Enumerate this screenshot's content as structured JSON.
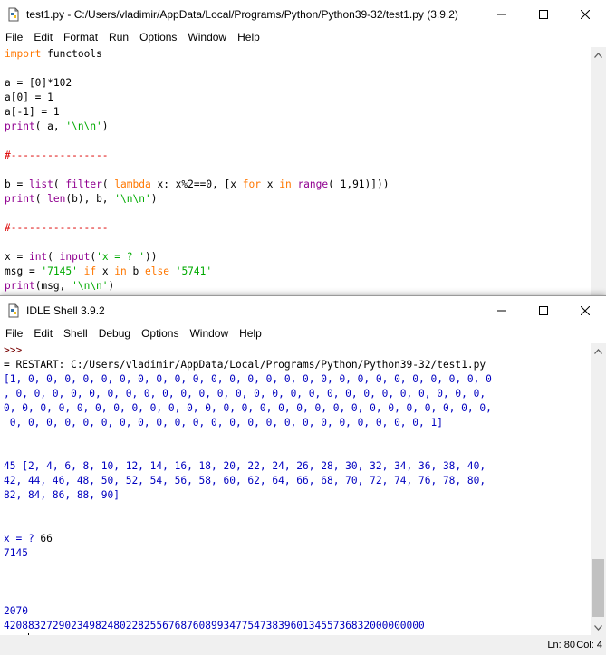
{
  "editor": {
    "title": "test1.py - C:/Users/vladimir/AppData/Local/Programs/Python/Python39-32/test1.py (3.9.2)",
    "menu": [
      "File",
      "Edit",
      "Format",
      "Run",
      "Options",
      "Window",
      "Help"
    ],
    "code": {
      "l1_kw": "import",
      "l1_rest": " functools",
      "l3": "a = [0]*102",
      "l4": "a[0] = 1",
      "l5": "a[-1] = 1",
      "l6_bi": "print",
      "l6_a": "( a, ",
      "l6_str": "'\\n\\n'",
      "l6_b": ")",
      "l8_cmt": "#----------------",
      "l10_a": "b = ",
      "l10_bi1": "list",
      "l10_b": "( ",
      "l10_bi2": "filter",
      "l10_c": "( ",
      "l10_kw1": "lambda",
      "l10_d": " x: x%2==0, [x ",
      "l10_kw2": "for",
      "l10_e": " x ",
      "l10_kw3": "in",
      "l10_f": " ",
      "l10_bi3": "range",
      "l10_g": "( 1,91)]))",
      "l11_bi1": "print",
      "l11_a": "( ",
      "l11_bi2": "len",
      "l11_b": "(b), b, ",
      "l11_str": "'\\n\\n'",
      "l11_c": ")",
      "l13_cmt": "#----------------",
      "l15_a": "x = ",
      "l15_bi1": "int",
      "l15_b": "( ",
      "l15_bi2": "input",
      "l15_c": "(",
      "l15_str": "'x = ? '",
      "l15_d": "))",
      "l16_a": "msg = ",
      "l16_str1": "'7145'",
      "l16_b": " ",
      "l16_kw1": "if",
      "l16_c": " x ",
      "l16_kw2": "in",
      "l16_d": " b ",
      "l16_kw3": "else",
      "l16_e": " ",
      "l16_str2": "'5741'",
      "l17_bi": "print",
      "l17_a": "(msg, ",
      "l17_str": "'\\n\\n'",
      "l17_b": ")"
    }
  },
  "shell": {
    "title": "IDLE Shell 3.9.2",
    "menu": [
      "File",
      "Edit",
      "Shell",
      "Debug",
      "Options",
      "Window",
      "Help"
    ],
    "prompt": ">>>",
    "restart": "= RESTART: C:/Users/vladimir/AppData/Local/Programs/Python/Python39-32/test1.py",
    "out1": "[1, 0, 0, 0, 0, 0, 0, 0, 0, 0, 0, 0, 0, 0, 0, 0, 0, 0, 0, 0, 0, 0, 0, 0, 0, 0, 0",
    "out2": ", 0, 0, 0, 0, 0, 0, 0, 0, 0, 0, 0, 0, 0, 0, 0, 0, 0, 0, 0, 0, 0, 0, 0, 0, 0, 0,",
    "out3": "0, 0, 0, 0, 0, 0, 0, 0, 0, 0, 0, 0, 0, 0, 0, 0, 0, 0, 0, 0, 0, 0, 0, 0, 0, 0, 0,",
    "out4": " 0, 0, 0, 0, 0, 0, 0, 0, 0, 0, 0, 0, 0, 0, 0, 0, 0, 0, 0, 0, 0, 0, 0, 1]",
    "out5": "45 [2, 4, 6, 8, 10, 12, 14, 16, 18, 20, 22, 24, 26, 28, 30, 32, 34, 36, 38, 40,",
    "out6": "42, 44, 46, 48, 50, 52, 54, 56, 58, 60, 62, 64, 66, 68, 70, 72, 74, 76, 78, 80,",
    "out7": "82, 84, 86, 88, 90]",
    "input_prompt": "x = ? ",
    "input_value": "66",
    "out8": "7145",
    "out9": "2070",
    "out10": "420883272902349824802282556768760899347754738396013455736832000000000",
    "status": {
      "ln": "Ln: 80",
      "col": "Col: 4"
    }
  }
}
